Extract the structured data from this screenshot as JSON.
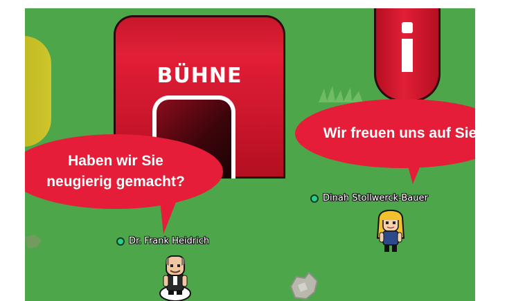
{
  "map": {
    "ground_color": "#4ea64b",
    "accent_color": "#e51d38",
    "stage_building": {
      "sign_label": "BÜHNE"
    },
    "info_building": {
      "icon": "info-icon"
    }
  },
  "speech_bubbles": [
    {
      "text": "Haben wir Sie\nneugierig gemacht?",
      "speaker": "Dr. Frank Heidrich"
    },
    {
      "text": "Wir freuen uns auf Sie!",
      "speaker": "Dinah Stollwerck-Bauer"
    }
  ],
  "players": [
    {
      "name": "Dr. Frank Heidrich",
      "status_color": "#23d18b"
    },
    {
      "name": "Dinah Stollwerck-Bauer",
      "status_color": "#23d18b"
    }
  ]
}
